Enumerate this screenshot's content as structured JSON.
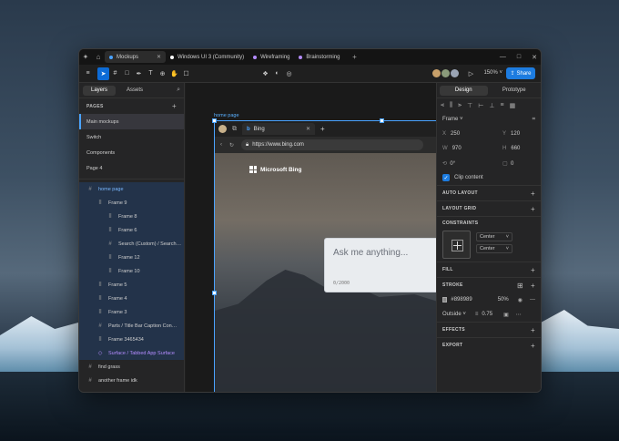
{
  "titlebar": {
    "tabs": [
      {
        "label": "Mockups",
        "color": "#4aa3ff",
        "active": true
      },
      {
        "label": "Windows UI 3 (Community)",
        "color": "#ffffff",
        "active": false
      },
      {
        "label": "Wireframing",
        "color": "#b48cff",
        "active": false
      },
      {
        "label": "Brainstorming",
        "color": "#b48cff",
        "active": false
      }
    ]
  },
  "toolbar": {
    "zoom": "150%",
    "share_label": "Share"
  },
  "left_panel": {
    "tabs": [
      "Layers",
      "Assets"
    ],
    "pages_heading": "PAGES",
    "pages": [
      "Main mockups",
      "Switch",
      "Components",
      "Page 4"
    ],
    "layers": [
      {
        "label": "home page",
        "icon": "#",
        "indent": 0,
        "state": "hl"
      },
      {
        "label": "Frame 9",
        "icon": "ⅼⅼ",
        "indent": 1,
        "state": "sel"
      },
      {
        "label": "Frame 8",
        "icon": "ⅼⅼ",
        "indent": 2,
        "state": "sel"
      },
      {
        "label": "Frame 6",
        "icon": "ⅼⅼ",
        "indent": 2,
        "state": "sel"
      },
      {
        "label": "Search (Custom) / Search…",
        "icon": "#",
        "indent": 2,
        "state": "sel"
      },
      {
        "label": "Frame 12",
        "icon": "ⅼⅼ",
        "indent": 2,
        "state": "sel"
      },
      {
        "label": "Frame 10",
        "icon": "ⅼⅼ",
        "indent": 2,
        "state": "sel"
      },
      {
        "label": "Frame 5",
        "icon": "ⅼⅼ",
        "indent": 1,
        "state": "sel"
      },
      {
        "label": "Frame 4",
        "icon": "ⅼⅼ",
        "indent": 1,
        "state": "sel"
      },
      {
        "label": "Frame 3",
        "icon": "ⅼⅼ",
        "indent": 1,
        "state": "sel"
      },
      {
        "label": "Parts / Title Bar Caption Con…",
        "icon": "#",
        "indent": 1,
        "state": "sel"
      },
      {
        "label": "Frame 3465434",
        "icon": "ⅼⅼ",
        "indent": 1,
        "state": "sel"
      },
      {
        "label": "Surface / Tabbed App Surface",
        "icon": "◇",
        "indent": 1,
        "state": "sel comp"
      },
      {
        "label": "find grass",
        "icon": "#",
        "indent": 0,
        "state": ""
      },
      {
        "label": "another frame idk",
        "icon": "#",
        "indent": 0,
        "state": ""
      }
    ]
  },
  "canvas": {
    "frame_label": "home page",
    "browser_tab": "Bing",
    "url": "https://www.bing.com",
    "brand": "Microsoft Bing",
    "search_placeholder": "Ask me anything...",
    "char_count": "0/2000"
  },
  "right_panel": {
    "tabs": [
      "Design",
      "Prototype"
    ],
    "frame_type": "Frame",
    "x": "250",
    "y": "120",
    "w": "970",
    "h": "660",
    "rotation": "0°",
    "radius": "0",
    "clip_label": "Clip content",
    "sections": [
      "AUTO LAYOUT",
      "LAYOUT GRID",
      "CONSTRAINTS",
      "FILL",
      "STROKE",
      "EFFECTS",
      "EXPORT"
    ],
    "constraint_h": "Center",
    "constraint_v": "Center",
    "stroke_color": "#898989",
    "stroke_opacity": "50%",
    "stroke_position": "Outside",
    "stroke_width": "0.75"
  }
}
